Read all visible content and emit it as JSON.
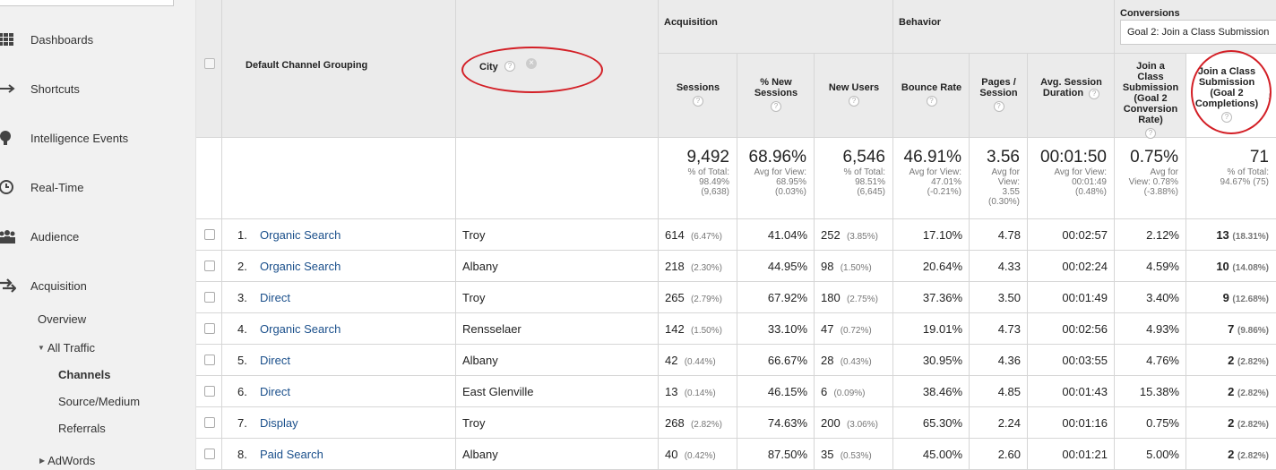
{
  "sidebar": {
    "items": [
      {
        "label": "Dashboards",
        "icon": "grid-icon"
      },
      {
        "label": "Shortcuts",
        "icon": "shortcut-arrow-icon"
      },
      {
        "label": "Intelligence Events",
        "icon": "lightbulb-icon"
      },
      {
        "label": "Real-Time",
        "icon": "clock-icon"
      },
      {
        "label": "Audience",
        "icon": "people-icon"
      },
      {
        "label": "Acquisition",
        "icon": "arrows-icon"
      }
    ],
    "sub": {
      "overview": "Overview",
      "all_traffic": "All Traffic",
      "channels": "Channels",
      "source_medium": "Source/Medium",
      "referrals": "Referrals",
      "adwords": "AdWords"
    }
  },
  "header": {
    "primary_dimension": "Default Channel Grouping",
    "secondary_dimension": "City",
    "groups": {
      "acquisition": "Acquisition",
      "behavior": "Behavior",
      "conversions": "Conversions"
    },
    "goal_select": "Goal 2: Join a Class Submission",
    "columns": [
      {
        "lines": [
          "Sessions"
        ]
      },
      {
        "lines": [
          "% New",
          "Sessions"
        ]
      },
      {
        "lines": [
          "New Users"
        ]
      },
      {
        "lines": [
          "Bounce Rate"
        ]
      },
      {
        "lines": [
          "Pages /",
          "Session"
        ]
      },
      {
        "lines": [
          "Avg. Session",
          "Duration"
        ]
      },
      {
        "lines": [
          "Join a",
          "Class",
          "Submission",
          "(Goal 2",
          "Conversion",
          "Rate)"
        ]
      },
      {
        "lines": [
          "Join a Class",
          "Submission",
          "(Goal 2",
          "Completions)"
        ]
      }
    ]
  },
  "totals": [
    {
      "big": "9,492",
      "small": [
        "% of Total:",
        "98.49%",
        "(9,638)"
      ]
    },
    {
      "big": "68.96%",
      "small": [
        "Avg for View:",
        "68.95%",
        "(0.03%)"
      ]
    },
    {
      "big": "6,546",
      "small": [
        "% of Total:",
        "98.51%",
        "(6,645)"
      ]
    },
    {
      "big": "46.91%",
      "small": [
        "Avg for View:",
        "47.01%",
        "(-0.21%)"
      ]
    },
    {
      "big": "3.56",
      "small": [
        "Avg for",
        "View:",
        "3.55",
        "(0.30%)"
      ]
    },
    {
      "big": "00:01:50",
      "small": [
        "Avg for View:",
        "00:01:49",
        "(0.48%)"
      ]
    },
    {
      "big": "0.75%",
      "small": [
        "Avg for",
        "View: 0.78%",
        "(-3.88%)"
      ]
    },
    {
      "big": "71",
      "small": [
        "% of Total:",
        "94.67% (75)"
      ]
    }
  ],
  "rows": [
    {
      "num": "1.",
      "channel": "Organic Search",
      "city": "Troy",
      "sessions": "614",
      "sessions_pct": "(6.47%)",
      "new_sessions": "41.04%",
      "new_users": "252",
      "new_users_pct": "(3.85%)",
      "bounce": "17.10%",
      "pages": "4.78",
      "duration": "00:02:57",
      "conv_rate": "2.12%",
      "completions": "13",
      "completions_pct": "(18.31%)"
    },
    {
      "num": "2.",
      "channel": "Organic Search",
      "city": "Albany",
      "sessions": "218",
      "sessions_pct": "(2.30%)",
      "new_sessions": "44.95%",
      "new_users": "98",
      "new_users_pct": "(1.50%)",
      "bounce": "20.64%",
      "pages": "4.33",
      "duration": "00:02:24",
      "conv_rate": "4.59%",
      "completions": "10",
      "completions_pct": "(14.08%)"
    },
    {
      "num": "3.",
      "channel": "Direct",
      "city": "Troy",
      "sessions": "265",
      "sessions_pct": "(2.79%)",
      "new_sessions": "67.92%",
      "new_users": "180",
      "new_users_pct": "(2.75%)",
      "bounce": "37.36%",
      "pages": "3.50",
      "duration": "00:01:49",
      "conv_rate": "3.40%",
      "completions": "9",
      "completions_pct": "(12.68%)"
    },
    {
      "num": "4.",
      "channel": "Organic Search",
      "city": "Rensselaer",
      "sessions": "142",
      "sessions_pct": "(1.50%)",
      "new_sessions": "33.10%",
      "new_users": "47",
      "new_users_pct": "(0.72%)",
      "bounce": "19.01%",
      "pages": "4.73",
      "duration": "00:02:56",
      "conv_rate": "4.93%",
      "completions": "7",
      "completions_pct": "(9.86%)"
    },
    {
      "num": "5.",
      "channel": "Direct",
      "city": "Albany",
      "sessions": "42",
      "sessions_pct": "(0.44%)",
      "new_sessions": "66.67%",
      "new_users": "28",
      "new_users_pct": "(0.43%)",
      "bounce": "30.95%",
      "pages": "4.36",
      "duration": "00:03:55",
      "conv_rate": "4.76%",
      "completions": "2",
      "completions_pct": "(2.82%)"
    },
    {
      "num": "6.",
      "channel": "Direct",
      "city": "East Glenville",
      "sessions": "13",
      "sessions_pct": "(0.14%)",
      "new_sessions": "46.15%",
      "new_users": "6",
      "new_users_pct": "(0.09%)",
      "bounce": "38.46%",
      "pages": "4.85",
      "duration": "00:01:43",
      "conv_rate": "15.38%",
      "completions": "2",
      "completions_pct": "(2.82%)"
    },
    {
      "num": "7.",
      "channel": "Display",
      "city": "Troy",
      "sessions": "268",
      "sessions_pct": "(2.82%)",
      "new_sessions": "74.63%",
      "new_users": "200",
      "new_users_pct": "(3.06%)",
      "bounce": "65.30%",
      "pages": "2.24",
      "duration": "00:01:16",
      "conv_rate": "0.75%",
      "completions": "2",
      "completions_pct": "(2.82%)"
    },
    {
      "num": "8.",
      "channel": "Paid Search",
      "city": "Albany",
      "sessions": "40",
      "sessions_pct": "(0.42%)",
      "new_sessions": "87.50%",
      "new_users": "35",
      "new_users_pct": "(0.53%)",
      "bounce": "45.00%",
      "pages": "2.60",
      "duration": "00:01:21",
      "conv_rate": "5.00%",
      "completions": "2",
      "completions_pct": "(2.82%)"
    }
  ],
  "colors": {
    "link": "#1a4f8b",
    "annotation": "#d31f26",
    "header_bg": "#ebebeb"
  }
}
